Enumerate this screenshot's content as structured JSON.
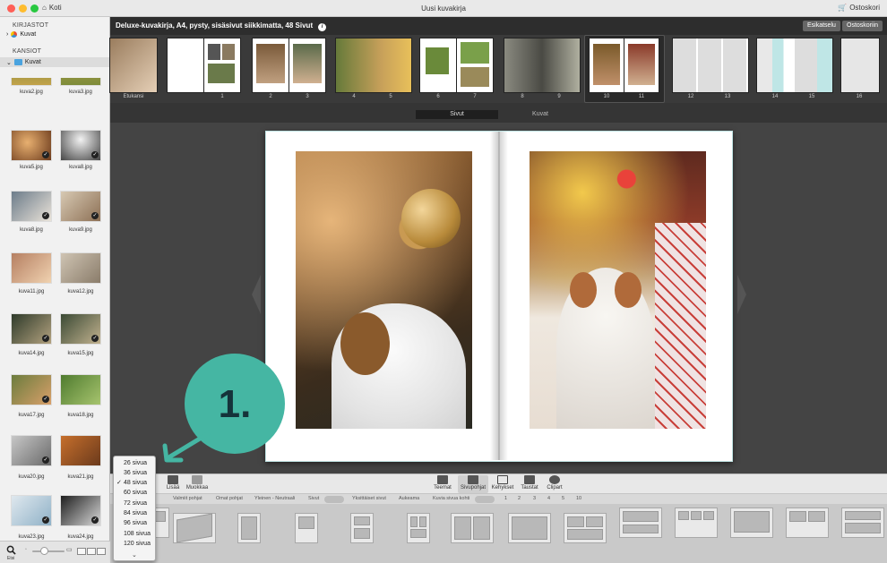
{
  "window": {
    "home_label": "Koti",
    "title": "Uusi kuvakirja",
    "cart_label": "Ostoskori"
  },
  "sidebar": {
    "section1": "KIRJASTOT",
    "library_item": "Kuvat",
    "section2": "KANSIOT",
    "folder_item": "Kuvat",
    "thumbs": [
      "kuva2.jpg",
      "kuva3.jpg",
      "kuva5.jpg",
      "kuva8.jpg",
      "kuva8.jpg",
      "kuva9.jpg",
      "kuva11.jpg",
      "kuva12.jpg",
      "kuva14.jpg",
      "kuva15.jpg",
      "kuva17.jpg",
      "kuva18.jpg",
      "kuva20.jpg",
      "kuva21.jpg",
      "kuva23.jpg",
      "kuva24.jpg"
    ],
    "search_label": "Etsi"
  },
  "infobar": {
    "product": "Deluxe-kuvakirja, A4, pysty, sisäsivut siikkimatta, 48 Sivut",
    "preview": "Esikatselu",
    "add_to_cart": "Ostoskoriin"
  },
  "strip": {
    "labels": [
      "Etukansi",
      "1",
      "2",
      "3",
      "4",
      "5",
      "6",
      "7",
      "8",
      "9",
      "10",
      "11",
      "12",
      "13",
      "14",
      "15",
      "16"
    ]
  },
  "tabs": {
    "pages": "Sivut",
    "photos": "Kuvat"
  },
  "callout": {
    "text": "1."
  },
  "toolbar": {
    "add": "Lisää",
    "edit": "Muokkaa",
    "themes": "Teemat",
    "layouts": "Sivupohjat",
    "frames": "Kehykset",
    "backgrounds": "Taustat",
    "clipart": "Clipart"
  },
  "filterbar": {
    "own": "Valmiit pohjat",
    "my": "Omat pohjat",
    "general": "Yleinen - Neutraali",
    "pages": "Sivut",
    "single": "Yksittäiset sivut",
    "spread": "Aukeama",
    "per_page": "Kuvia sivua kohti",
    "nums": [
      "1",
      "2",
      "3",
      "4",
      "5",
      "10",
      "5"
    ]
  },
  "menu": {
    "items": [
      "26 sivua",
      "36 sivua",
      "48 sivua",
      "60 sivua",
      "72 sivua",
      "84 sivua",
      "96 sivua",
      "108 sivua",
      "120 sivua"
    ],
    "checked_index": 2,
    "check": "✓",
    "more": "⌄"
  }
}
